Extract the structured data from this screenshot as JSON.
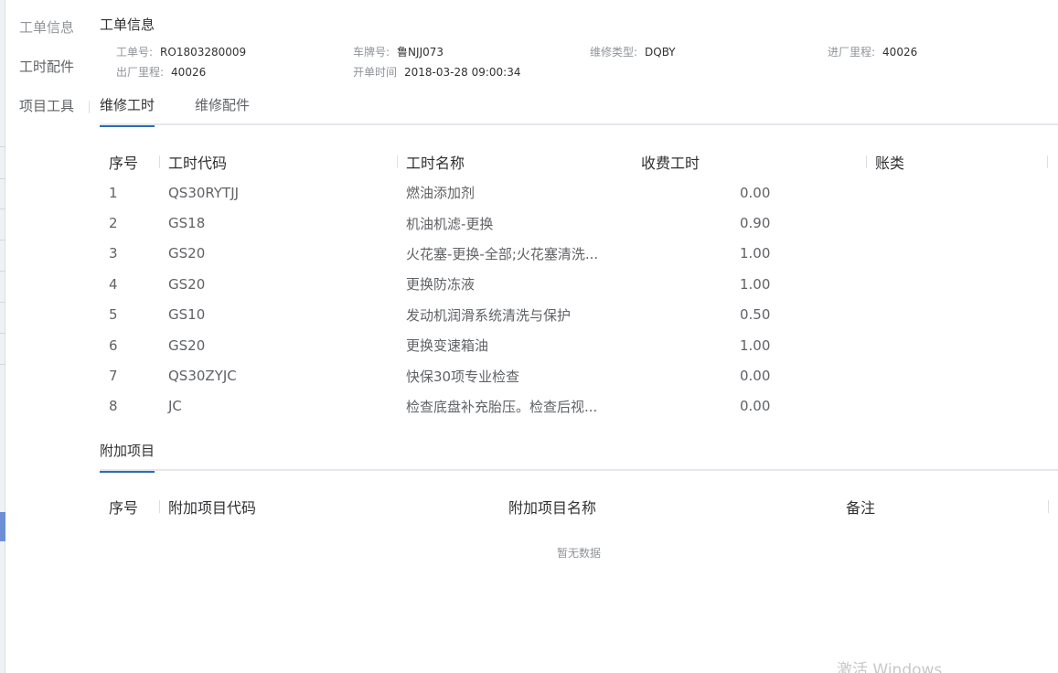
{
  "side_nav": [
    "工单信息",
    "工时配件",
    "项目工具"
  ],
  "section_title": "工单信息",
  "info": [
    [
      {
        "label": "工单号:",
        "value": "RO1803280009"
      },
      {
        "label": "车牌号:",
        "value": "鲁NJJ073"
      },
      {
        "label": "维修类型:",
        "value": "DQBY"
      },
      {
        "label": "进厂里程:",
        "value": "40026"
      }
    ],
    [
      {
        "label": "出厂里程:",
        "value": "40026"
      },
      {
        "label": "开单时间",
        "value": "2018-03-28 09:00:34"
      }
    ]
  ],
  "tabs": [
    {
      "label": "维修工时",
      "active": true
    },
    {
      "label": "维修配件",
      "active": false
    }
  ],
  "labor_table": {
    "columns": [
      "序号",
      "工时代码",
      "工时名称",
      "收费工时",
      "账类"
    ],
    "rows": [
      [
        "1",
        "QS30RYTJJ",
        "燃油添加剂",
        "0.00",
        ""
      ],
      [
        "2",
        "GS18",
        "机油机滤-更换",
        "0.90",
        ""
      ],
      [
        "3",
        "GS20",
        "火花塞-更换-全部;火花塞清洗...",
        "1.00",
        ""
      ],
      [
        "4",
        "GS20",
        "更换防冻液",
        "1.00",
        ""
      ],
      [
        "5",
        "GS10",
        "发动机润滑系统清洗与保护",
        "0.50",
        ""
      ],
      [
        "6",
        "GS20",
        "更换变速箱油",
        "1.00",
        ""
      ],
      [
        "7",
        "QS30ZYJC",
        "快保30项专业检查",
        "0.00",
        ""
      ],
      [
        "8",
        "JC",
        "检查底盘补充胎压。检查后视...",
        "0.00",
        ""
      ]
    ]
  },
  "extra_tab": "附加项目",
  "extra_table": {
    "columns": [
      "序号",
      "附加项目代码",
      "附加项目名称",
      "备注"
    ],
    "empty_text": "暂无数据"
  },
  "watermark": "激活 Windows"
}
